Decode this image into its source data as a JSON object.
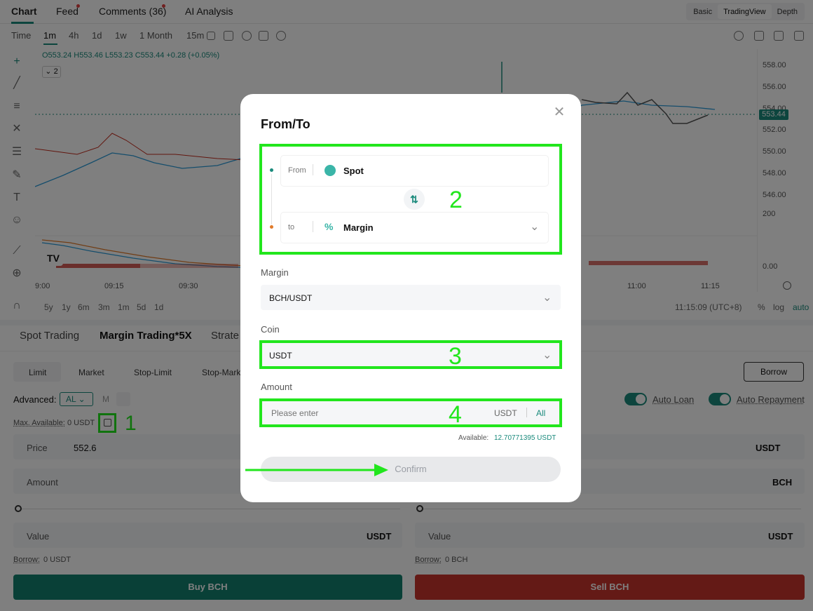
{
  "top_tabs": [
    "Chart",
    "Feed",
    "Comments (36)",
    "AI Analysis"
  ],
  "view_modes": [
    "Basic",
    "TradingView",
    "Depth"
  ],
  "timeframes": [
    "Time",
    "1m",
    "4h",
    "1d",
    "1w",
    "1 Month",
    "15m"
  ],
  "indicator_count": "2",
  "ohlc": "O553.24 H553.46 L553.23 C553.44 +0.28 (+0.05%)",
  "price_ticks": [
    "558.00",
    "556.00",
    "554.00",
    "552.00",
    "550.00",
    "548.00",
    "546.00",
    "200",
    "0.00"
  ],
  "current_price": "553.44",
  "time_ticks": [
    "9:00",
    "09:15",
    "09:30",
    "11:00",
    "11:15"
  ],
  "ranges": [
    "5y",
    "1y",
    "6m",
    "3m",
    "1m",
    "5d",
    "1d"
  ],
  "clock": "11:15:09 (UTC+8)",
  "scale_opts": [
    "%",
    "log",
    "auto"
  ],
  "trade_tabs": [
    "Spot Trading",
    "Margin Trading*5X",
    "Strate"
  ],
  "order_types": [
    "Limit",
    "Market",
    "Stop-Limit",
    "Stop-Marke"
  ],
  "borrow_btn": "Borrow",
  "advanced_label": "Advanced:",
  "advanced_value": "AL",
  "advanced_m": "M",
  "max_available": "Max. Available:",
  "max_available_value": "0 USDT",
  "auto_loan": "Auto Loan",
  "auto_repayment": "Auto Repayment",
  "buy": {
    "price_label": "Price",
    "price_value": "552.6",
    "amount_label": "Amount",
    "value_label": "Value",
    "value_unit": "USDT",
    "borrow_label": "Borrow:",
    "borrow_value": "0 USDT",
    "button": "Buy BCH"
  },
  "sell": {
    "price_unit": "USDT",
    "amount_unit": "BCH",
    "value_label": "Value",
    "value_unit": "USDT",
    "borrow_label": "Borrow:",
    "borrow_value": "0 BCH",
    "button": "Sell BCH"
  },
  "modal": {
    "title": "From/To",
    "from_label": "From",
    "from_value": "Spot",
    "to_label": "to",
    "to_value": "Margin",
    "margin_label": "Margin",
    "margin_value": "BCH/USDT",
    "coin_label": "Coin",
    "coin_value": "USDT",
    "amount_label": "Amount",
    "amount_placeholder": "Please enter",
    "amount_unit": "USDT",
    "amount_all": "All",
    "available_label": "Available:",
    "available_value": "12.70771395 USDT",
    "confirm": "Confirm"
  },
  "annotations": [
    "1",
    "2",
    "3",
    "4"
  ],
  "colors": {
    "accent": "#1a8a7c",
    "sell": "#c9342c",
    "highlight": "#22e61d"
  }
}
